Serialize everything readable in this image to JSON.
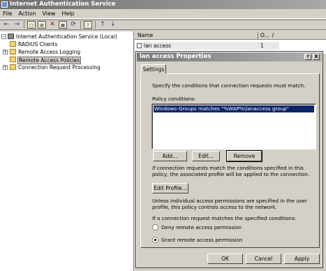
{
  "window": {
    "title": "Internet Authentication Service"
  },
  "menu": [
    "File",
    "Action",
    "View",
    "Help"
  ],
  "toolbar": {
    "icons": [
      "back-icon",
      "forward-icon",
      "up-folder-icon",
      "show-hide-tree-icon",
      "delete-icon",
      "properties-icon",
      "refresh-icon",
      "help-icon",
      "move-up-icon",
      "move-down-icon"
    ]
  },
  "tree": {
    "root": "Internet Authentication Service (Local)",
    "items": [
      "RADIUS Clients",
      "Remote Access Logging",
      "Remote Access Policies",
      "Connection Request Processing"
    ]
  },
  "list": {
    "columns": [
      "Name",
      "O...",
      "/"
    ],
    "rows": [
      {
        "name": "lan access",
        "order": "1"
      }
    ]
  },
  "dialog": {
    "title": "lan access Properties",
    "help_btn": "?",
    "close_btn": "X",
    "tab": "Settings",
    "intro": "Specify the conditions that connection requests must match.",
    "conditions_label": "Policy conditions:",
    "conditions": [
      "Windows-Groups matches \"%WAP%\\lanaccess group\""
    ],
    "add_btn": "Add...",
    "edit_btn": "Edit...",
    "remove_btn": "Remove",
    "match_text": "If connection requests match the conditions specified in this policy, the associated profile will be applied to the connection.",
    "edit_profile_btn": "Edit Profile...",
    "permission_text": "Unless individual access permissions are specified in the user profile, this policy controls access to the network.",
    "if_match_label": "If a connection request matches the specified conditions:",
    "deny_option": "Deny remote access permission",
    "grant_option": "Grant remote access permission",
    "ok_btn": "OK",
    "cancel_btn": "Cancel",
    "apply_btn": "Apply"
  }
}
